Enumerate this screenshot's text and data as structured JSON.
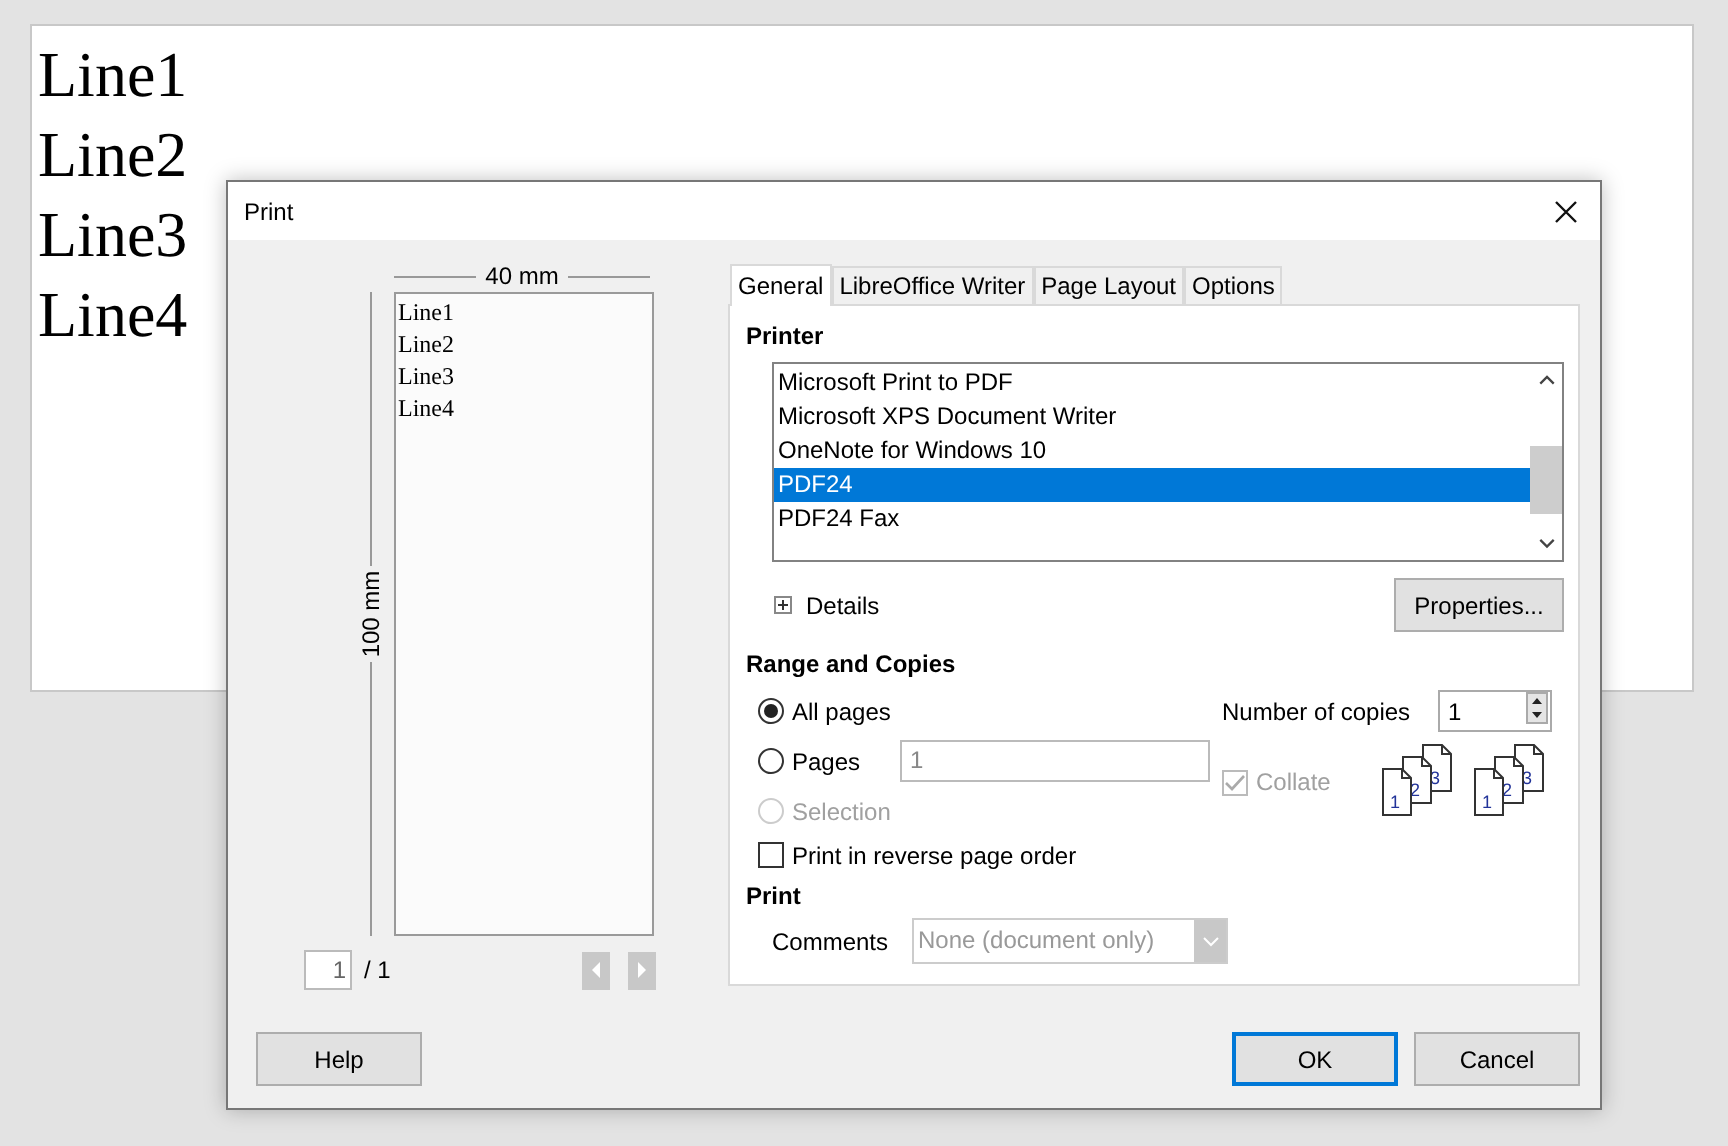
{
  "document": {
    "lines": [
      "Line1",
      "Line2",
      "Line3",
      "Line4"
    ]
  },
  "dialog": {
    "title": "Print"
  },
  "preview": {
    "width_label": "40 mm",
    "height_label": "100 mm",
    "lines": [
      "Line1",
      "Line2",
      "Line3",
      "Line4"
    ],
    "page_value": "1",
    "page_total": "/ 1"
  },
  "tabs": [
    {
      "label": "General",
      "selected": true
    },
    {
      "label": "LibreOffice Writer",
      "selected": false
    },
    {
      "label": "Page Layout",
      "selected": false
    },
    {
      "label": "Options",
      "selected": false
    }
  ],
  "printer": {
    "heading": "Printer",
    "items": [
      {
        "name": "Microsoft Print to PDF",
        "selected": false
      },
      {
        "name": "Microsoft XPS Document Writer",
        "selected": false
      },
      {
        "name": "OneNote for Windows 10",
        "selected": false
      },
      {
        "name": "PDF24",
        "selected": true
      },
      {
        "name": "PDF24 Fax",
        "selected": false
      }
    ],
    "details": "Details",
    "details_expanded": false,
    "properties": "Properties..."
  },
  "range": {
    "heading": "Range and Copies",
    "options": [
      {
        "label": "All pages",
        "selected": true,
        "disabled": false
      },
      {
        "label": "Pages",
        "selected": false,
        "disabled": false
      },
      {
        "label": "Selection",
        "selected": false,
        "disabled": true
      }
    ],
    "pages_value": "1",
    "reverse": {
      "label": "Print in reverse page order",
      "checked": false
    },
    "copies_label": "Number of copies",
    "copies_value": "1",
    "collate": {
      "label": "Collate",
      "checked": true,
      "disabled": true
    },
    "collate_drawings": [
      [
        "1",
        "2",
        "3"
      ],
      [
        "1",
        "2",
        "3"
      ]
    ]
  },
  "print": {
    "heading": "Print",
    "comments_label": "Comments",
    "comments_value": "None (document only)"
  },
  "buttons": {
    "help": "Help",
    "ok": "OK",
    "cancel": "Cancel"
  }
}
